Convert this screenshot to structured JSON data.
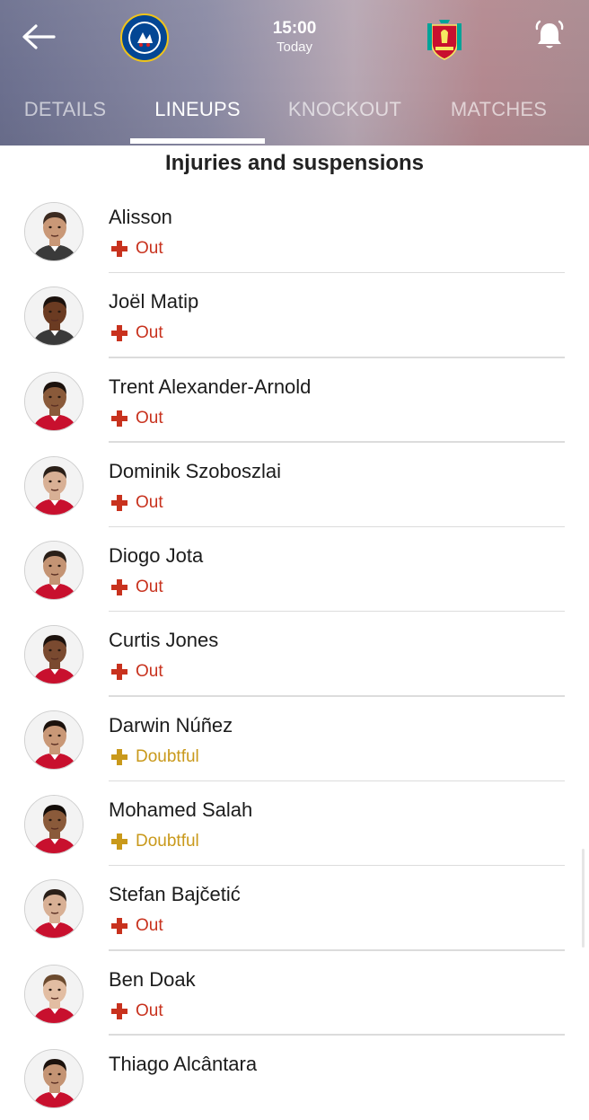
{
  "header": {
    "kickoff_time": "15:00",
    "kickoff_day": "Today",
    "home_club_icon": "chelsea-crest",
    "away_club_icon": "liverpool-crest"
  },
  "tabs": [
    {
      "label": "DETAILS",
      "active": false
    },
    {
      "label": "LINEUPS",
      "active": true
    },
    {
      "label": "KNOCKOUT",
      "active": false
    },
    {
      "label": "MATCHES",
      "active": false
    }
  ],
  "section_title": "Injuries and suspensions",
  "players": [
    {
      "name": "Alisson",
      "status": "Out",
      "skin": "#c99877",
      "hair": "#3b2a20",
      "kit": "#3a3a3a"
    },
    {
      "name": "Joël Matip",
      "status": "Out",
      "skin": "#6b3b22",
      "hair": "#1c120d",
      "kit": "#3a3a3a"
    },
    {
      "name": "Trent Alexander-Arnold",
      "status": "Out",
      "skin": "#8a5a3a",
      "hair": "#1c120d",
      "kit": "#c8102e"
    },
    {
      "name": "Dominik Szoboszlai",
      "status": "Out",
      "skin": "#d8b095",
      "hair": "#2a1f18",
      "kit": "#c8102e"
    },
    {
      "name": "Diogo Jota",
      "status": "Out",
      "skin": "#c49474",
      "hair": "#2a1f18",
      "kit": "#c8102e"
    },
    {
      "name": "Curtis Jones",
      "status": "Out",
      "skin": "#7a4a30",
      "hair": "#1c120d",
      "kit": "#c8102e"
    },
    {
      "name": "Darwin Núñez",
      "status": "Doubtful",
      "skin": "#c99877",
      "hair": "#1c120d",
      "kit": "#c8102e"
    },
    {
      "name": "Mohamed Salah",
      "status": "Doubtful",
      "skin": "#8a5a3a",
      "hair": "#120c08",
      "kit": "#c8102e"
    },
    {
      "name": "Stefan Bajčetić",
      "status": "Out",
      "skin": "#d8b095",
      "hair": "#2a1f18",
      "kit": "#c8102e"
    },
    {
      "name": "Ben Doak",
      "status": "Out",
      "skin": "#e2bda2",
      "hair": "#6b4a2e",
      "kit": "#c8102e"
    },
    {
      "name": "Thiago Alcântara",
      "status": "",
      "skin": "#c49474",
      "hair": "#1c120d",
      "kit": "#c8102e"
    }
  ],
  "colors": {
    "out": "#c8321e",
    "doubtful": "#c9991b",
    "divider": "#dcdcdc"
  }
}
